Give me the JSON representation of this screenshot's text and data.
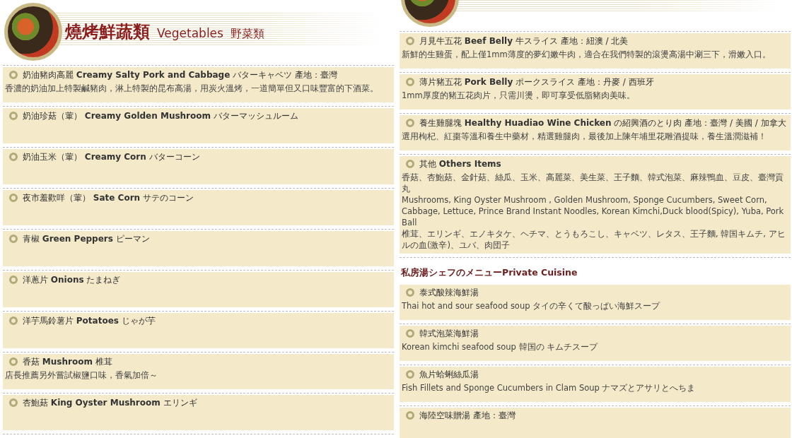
{
  "columns": [
    {
      "header": {
        "title_zh": "燒烤鮮蔬類",
        "title_en": "Vegetables",
        "title_ja": "野菜類"
      },
      "items": [
        {
          "kind": "dish",
          "name": "奶油豬肉高麗 **Creamy Salty Pork and Cabbage** バターキャベツ  產地：臺灣",
          "description": [
            "香濃的奶油加上特製鹹豬肉，淋上特製的昆布高湯，用炭火溫烤，一道簡單但又口味豐富的下酒菜。"
          ]
        },
        {
          "kind": "dish",
          "name": "奶油珍菇（葷） **Creamy Golden Mushroom** バターマッシュルーム"
        },
        {
          "kind": "dish",
          "name": "奶油玉米（葷） **Creamy Corn** バターコーン"
        },
        {
          "kind": "dish",
          "name": "夜市羞歡咩（葷） **Sate Corn** サテのコーン"
        },
        {
          "kind": "dish",
          "name": "青椒 **Green Peppers** ピーマン"
        },
        {
          "kind": "dish",
          "name": "洋蔥片 **Onions** たまねぎ"
        },
        {
          "kind": "dish",
          "name": "洋芋馬鈴薯片 **Potatoes** じゃが芋"
        },
        {
          "kind": "dish",
          "name": "香菇 **Mushroom** 椎茸",
          "description": [
            "店長推薦另外嘗試椒鹽口味，香氣加倍～"
          ]
        },
        {
          "kind": "dish",
          "name": "杏鮑菇 **King Oyster Mushroom** エリンギ"
        }
      ]
    },
    {
      "items": [
        {
          "kind": "dish",
          "name": "月見牛五花 **Beef Belly** 牛スライス  產地：紐澳 / 北美",
          "description": [
            "新鮮的生雞蛋，配上僅1mm薄度的夢幻嫩牛肉，適合在我們特製的滾燙高湯中涮三下，滑嫩入口。"
          ]
        },
        {
          "kind": "dish",
          "name": "薄片豬五花 **Pork Belly** ポークスライス  產地：丹麥 / 西班牙",
          "description": [
            "1mm厚度的豬五花肉片，只需川燙，即可享受低脂豬肉美味。"
          ]
        },
        {
          "kind": "dish",
          "name": "養生雞腿塊 **Healthy Huadiao Wine Chicken** の紹興酒のとり肉  產地：臺灣 / 美國 / 加拿大",
          "description": [
            "選用枸杞、紅棗等溫和養生中藥材，精選雞腿肉，最後加上陳年埔里花雕酒提味，養生溫潤滋補！"
          ]
        },
        {
          "kind": "dish",
          "name": "其他 **Others Items**",
          "description": [
            "香菇、杏鮑菇、金針菇、絲瓜、玉米、高麗菜、美生菜、王子麵、韓式泡菜、麻辣鴨血、豆皮、臺灣貢丸",
            "Mushrooms, King Oyster Mushroom , Golden Mushroom, Sponge Cucumbers, Sweet Corn, Cabbage, Lettuce, Prince Brand Instant Noodles, Korean Kimchi,Duck blood(Spicy), Yuba, Pork Ball",
            "椎茸、エリンギ、エノキタケ、ヘチマ、とうもろこし、キャベツ、レタス、王子麵, 韓国キムチ, アヒルの血(激辛)、ユバ、肉団子"
          ]
        },
        {
          "kind": "heading",
          "name": "私房湯シェフのメニューPrivate Cuisine"
        },
        {
          "kind": "dish",
          "name": "泰式酸辣海鮮湯",
          "description": [
            "Thai hot and sour seafood soup タイの辛くて酸っぱい海鮮スープ"
          ]
        },
        {
          "kind": "dish",
          "name": "韓式泡菜海鮮湯",
          "description": [
            "Korean kimchi seafood soup 韓国の キムチスープ"
          ]
        },
        {
          "kind": "dish",
          "name": "魚片蛤蜊絲瓜湯",
          "description": [
            "Fish Fillets and Sponge Cucumbers in Clam Soup ナマズとアサリとへちま"
          ]
        },
        {
          "kind": "dish",
          "name": "海陸空味贈湯 產地：臺灣"
        }
      ]
    }
  ]
}
